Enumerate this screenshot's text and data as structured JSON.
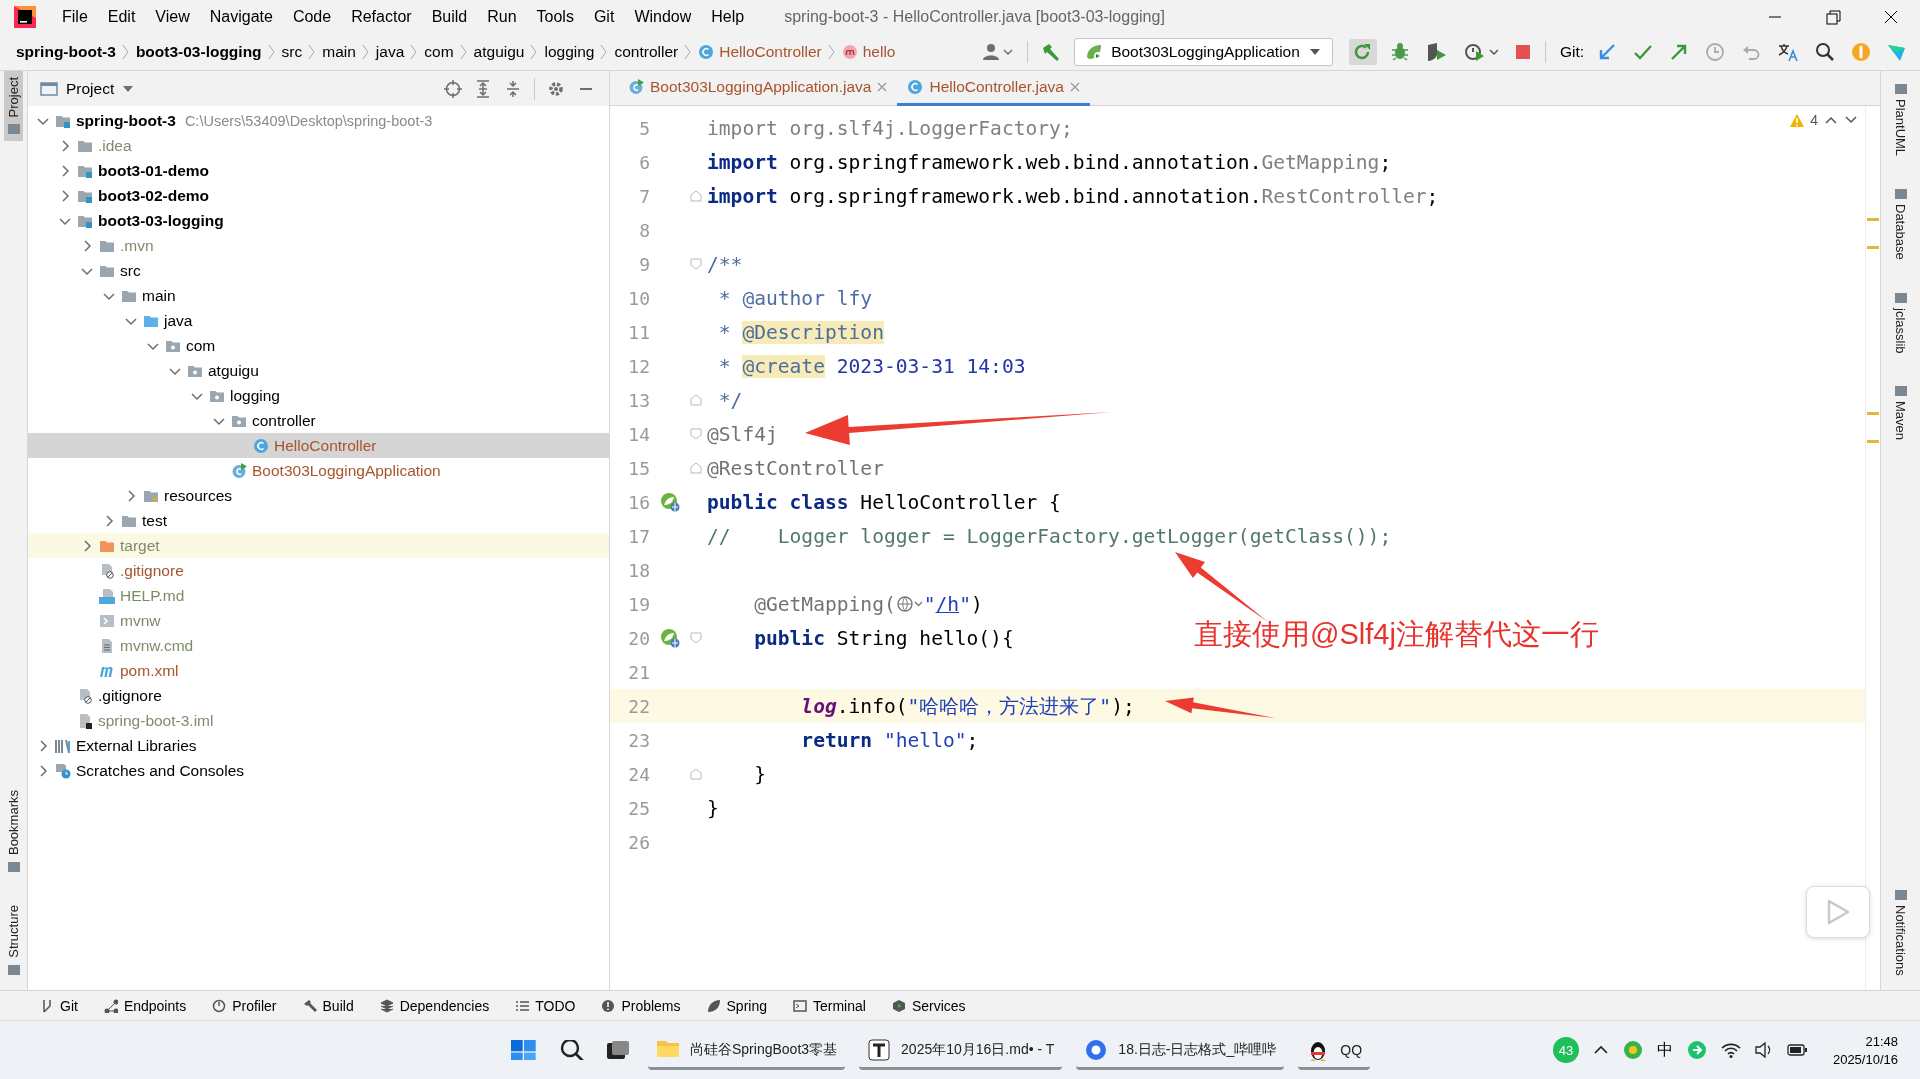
{
  "window": {
    "title": "spring-boot-3 - HelloController.java [boot3-03-logging]"
  },
  "menu_bar": {
    "items": [
      "File",
      "Edit",
      "View",
      "Navigate",
      "Code",
      "Refactor",
      "Build",
      "Run",
      "Tools",
      "Git",
      "Window",
      "Help"
    ]
  },
  "breadcrumbs": [
    {
      "label": "spring-boot-3",
      "kind": "module"
    },
    {
      "label": "boot3-03-logging",
      "kind": "module"
    },
    {
      "label": "src",
      "kind": "folder"
    },
    {
      "label": "main",
      "kind": "folder"
    },
    {
      "label": "java",
      "kind": "folder"
    },
    {
      "label": "com",
      "kind": "folder"
    },
    {
      "label": "atguigu",
      "kind": "folder"
    },
    {
      "label": "logging",
      "kind": "folder"
    },
    {
      "label": "controller",
      "kind": "folder"
    },
    {
      "label": "HelloController",
      "kind": "class"
    },
    {
      "label": "hello",
      "kind": "method"
    }
  ],
  "toolbar": {
    "run_configuration": "Boot303LoggingApplication",
    "git_label": "Git:"
  },
  "left_strip": {
    "top": [
      {
        "label": "Project",
        "selected": true
      }
    ],
    "bottom": [
      {
        "label": "Bookmarks",
        "selected": false
      },
      {
        "label": "Structure",
        "selected": false
      }
    ]
  },
  "right_strip": {
    "top": [
      {
        "label": "PlantUML"
      },
      {
        "label": "Database"
      },
      {
        "label": "jclasslib"
      },
      {
        "label": "Maven"
      }
    ],
    "bottom": [
      {
        "label": "Notifications"
      }
    ]
  },
  "project_panel": {
    "title": "Project",
    "tree": [
      {
        "label": "spring-boot-3",
        "path": "C:\\Users\\53409\\Desktop\\spring-boot-3",
        "kind": "module",
        "bold": true,
        "expanded": true,
        "selected": false,
        "children": [
          {
            "label": ".idea",
            "kind": "folder",
            "color": "#7d8c6a",
            "expanded": false,
            "selected": false
          },
          {
            "label": "boot3-01-demo",
            "kind": "module",
            "bold": true,
            "expanded": false,
            "selected": false
          },
          {
            "label": "boot3-02-demo",
            "kind": "module",
            "bold": true,
            "expanded": false,
            "selected": false
          },
          {
            "label": "boot3-03-logging",
            "kind": "module",
            "bold": true,
            "expanded": true,
            "selected": false,
            "children": [
              {
                "label": ".mvn",
                "kind": "folder",
                "color": "#7d8c6a",
                "expanded": false,
                "selected": false
              },
              {
                "label": "src",
                "kind": "folder",
                "expanded": true,
                "selected": false,
                "children": [
                  {
                    "label": "main",
                    "kind": "folder",
                    "expanded": true,
                    "selected": false,
                    "children": [
                      {
                        "label": "java",
                        "kind": "source",
                        "expanded": true,
                        "selected": false,
                        "children": [
                          {
                            "label": "com",
                            "kind": "package",
                            "expanded": true,
                            "selected": false,
                            "children": [
                              {
                                "label": "atguigu",
                                "kind": "package",
                                "expanded": true,
                                "selected": false,
                                "children": [
                                  {
                                    "label": "logging",
                                    "kind": "package",
                                    "expanded": true,
                                    "selected": false,
                                    "children": [
                                      {
                                        "label": "controller",
                                        "kind": "package",
                                        "expanded": true,
                                        "selected": false,
                                        "children": [
                                          {
                                            "label": "HelloController",
                                            "kind": "class",
                                            "color": "#a8542c",
                                            "selected": true
                                          }
                                        ]
                                      },
                                      {
                                        "label": "Boot303LoggingApplication",
                                        "kind": "app-class",
                                        "color": "#a8542c",
                                        "selected": false
                                      }
                                    ]
                                  }
                                ]
                              }
                            ]
                          }
                        ]
                      },
                      {
                        "label": "resources",
                        "kind": "resources",
                        "expanded": false,
                        "selected": false
                      }
                    ]
                  },
                  {
                    "label": "test",
                    "kind": "folder",
                    "expanded": false,
                    "selected": false
                  }
                ]
              },
              {
                "label": "target",
                "kind": "excluded",
                "color": "#7d8c6a",
                "expanded": false,
                "selected": false
              },
              {
                "label": ".gitignore",
                "kind": "gitignore",
                "color": "#a8542c",
                "selected": false
              },
              {
                "label": "HELP.md",
                "kind": "md",
                "color": "#7d8c6a",
                "selected": false
              },
              {
                "label": "mvnw",
                "kind": "script",
                "color": "#7d8c6a",
                "selected": false
              },
              {
                "label": "mvnw.cmd",
                "kind": "cmd",
                "color": "#7d8c6a",
                "selected": false
              },
              {
                "label": "pom.xml",
                "kind": "maven",
                "color": "#a8542c",
                "selected": false
              }
            ]
          },
          {
            "label": ".gitignore",
            "kind": "gitignore",
            "selected": false
          },
          {
            "label": "spring-boot-3.iml",
            "kind": "iml",
            "color": "#7d8c6a",
            "selected": false
          }
        ]
      },
      {
        "label": "External Libraries",
        "kind": "libraries",
        "expanded": false,
        "selected": false
      },
      {
        "label": "Scratches and Consoles",
        "kind": "scratches",
        "expanded": false,
        "selected": false
      }
    ]
  },
  "editor": {
    "tabs": [
      {
        "label": "Boot303LoggingApplication.java",
        "kind": "app-class",
        "color": "#a8542c",
        "selected": false
      },
      {
        "label": "HelloController.java",
        "kind": "class",
        "color": "#a8542c",
        "selected": true
      }
    ],
    "warning_count": "4",
    "lines": [
      {
        "number": "5",
        "current": false,
        "tokens": [
          {
            "kind": "unused",
            "text": "import org.slf4j.LoggerFactory;"
          }
        ]
      },
      {
        "number": "6",
        "current": false,
        "tokens": [
          {
            "kind": "kw",
            "text": "import"
          },
          {
            "kind": "plain",
            "text": " org.springframework.web.bind.annotation."
          },
          {
            "kind": "unused",
            "text": "GetMapping"
          },
          {
            "kind": "plain",
            "text": ";"
          }
        ]
      },
      {
        "number": "7",
        "current": false,
        "fold_end": true,
        "tokens": [
          {
            "kind": "kw",
            "text": "import"
          },
          {
            "kind": "plain",
            "text": " org.springframework.web.bind.annotation."
          },
          {
            "kind": "unused",
            "text": "RestController"
          },
          {
            "kind": "plain",
            "text": ";"
          }
        ]
      },
      {
        "number": "8",
        "current": false
      },
      {
        "number": "9",
        "current": false,
        "fold_start": true,
        "tokens": [
          {
            "kind": "doc",
            "text": "/**"
          }
        ]
      },
      {
        "number": "10",
        "current": false,
        "tokens": [
          {
            "kind": "doc",
            "text": " * "
          },
          {
            "kind": "tag",
            "text": "@author"
          },
          {
            "kind": "doc",
            "text": " lfy"
          }
        ]
      },
      {
        "number": "11",
        "current": false,
        "tokens": [
          {
            "kind": "doc",
            "text": " * "
          },
          {
            "kind": "tag-hl",
            "text": "@Description"
          }
        ]
      },
      {
        "number": "12",
        "current": false,
        "tokens": [
          {
            "kind": "doc",
            "text": " * "
          },
          {
            "kind": "tag-hl",
            "text": "@create"
          },
          {
            "kind": "docval",
            "text": " 2023-03-31 14:03"
          }
        ]
      },
      {
        "number": "13",
        "current": false,
        "fold_end": true,
        "tokens": [
          {
            "kind": "doc",
            "text": " */"
          }
        ]
      },
      {
        "number": "14",
        "current": false,
        "fold_start": true,
        "tokens": [
          {
            "kind": "anno",
            "text": "@Slf4j"
          }
        ]
      },
      {
        "number": "15",
        "current": false,
        "fold_end": true,
        "tokens": [
          {
            "kind": "anno",
            "text": "@RestController"
          }
        ]
      },
      {
        "number": "16",
        "current": false,
        "bean_marker": true,
        "tokens": [
          {
            "kind": "kw",
            "text": "public class"
          },
          {
            "kind": "plain",
            "text": " HelloController {"
          }
        ]
      },
      {
        "number": "17",
        "current": false,
        "tokens": [
          {
            "kind": "comment",
            "text": "//    Logger logger = LoggerFactory.getLogger(getClass());"
          }
        ]
      },
      {
        "number": "18",
        "current": false
      },
      {
        "number": "19",
        "current": false,
        "tokens": [
          {
            "kind": "anno",
            "text": "    @GetMapping("
          },
          {
            "kind": "globe"
          },
          {
            "kind": "string",
            "text": "\""
          },
          {
            "kind": "link",
            "text": "/h"
          },
          {
            "kind": "string",
            "text": "\""
          },
          {
            "kind": "plain",
            "text": ")"
          }
        ]
      },
      {
        "number": "20",
        "current": false,
        "bean_marker": true,
        "fold_start": true,
        "tokens": [
          {
            "kind": "kw",
            "text": "    public"
          },
          {
            "kind": "plain",
            "text": " String hello(){"
          }
        ]
      },
      {
        "number": "21",
        "current": false
      },
      {
        "number": "22",
        "current": true,
        "tokens": [
          {
            "kind": "static",
            "text": "        log"
          },
          {
            "kind": "plain",
            "text": ".info("
          },
          {
            "kind": "string",
            "text": "\"哈哈哈，方法进来了\""
          },
          {
            "kind": "plain",
            "text": ");"
          }
        ]
      },
      {
        "number": "23",
        "current": false,
        "tokens": [
          {
            "kind": "kw",
            "text": "        return"
          },
          {
            "kind": "string",
            "text": " \"hello\""
          },
          {
            "kind": "plain",
            "text": ";"
          }
        ]
      },
      {
        "number": "24",
        "current": false,
        "fold_end": true,
        "tokens": [
          {
            "kind": "plain",
            "text": "    }"
          }
        ]
      },
      {
        "number": "25",
        "current": false,
        "tokens": [
          {
            "kind": "plain",
            "text": "}"
          }
        ]
      },
      {
        "number": "26",
        "current": false
      }
    ]
  },
  "annotation": {
    "text": "直接使用@Slf4j注解替代这一行"
  },
  "tool_windows": [
    {
      "label": "Git",
      "kind": "git"
    },
    {
      "label": "Endpoints",
      "kind": "endpoints"
    },
    {
      "label": "Profiler",
      "kind": "profiler"
    },
    {
      "label": "Build",
      "kind": "build"
    },
    {
      "label": "Dependencies",
      "kind": "dependencies"
    },
    {
      "label": "TODO",
      "kind": "todo"
    },
    {
      "label": "Problems",
      "kind": "problems"
    },
    {
      "label": "Spring",
      "kind": "spring"
    },
    {
      "label": "Terminal",
      "kind": "terminal"
    },
    {
      "label": "Services",
      "kind": "services"
    }
  ],
  "taskbar": {
    "apps": [
      {
        "label": "尚硅谷SpringBoot3零基",
        "kind": "explorer",
        "running": true
      },
      {
        "label": "2025年10月16日.md• - T",
        "kind": "typora",
        "running": true
      },
      {
        "label": "18.日志-日志格式_哔哩哔",
        "kind": "browser",
        "running": true
      },
      {
        "label": "QQ",
        "kind": "qq",
        "running": true
      }
    ],
    "tray": {
      "badge": "43",
      "ime": "中",
      "time": "21:48",
      "date": "2025/10/16"
    }
  }
}
